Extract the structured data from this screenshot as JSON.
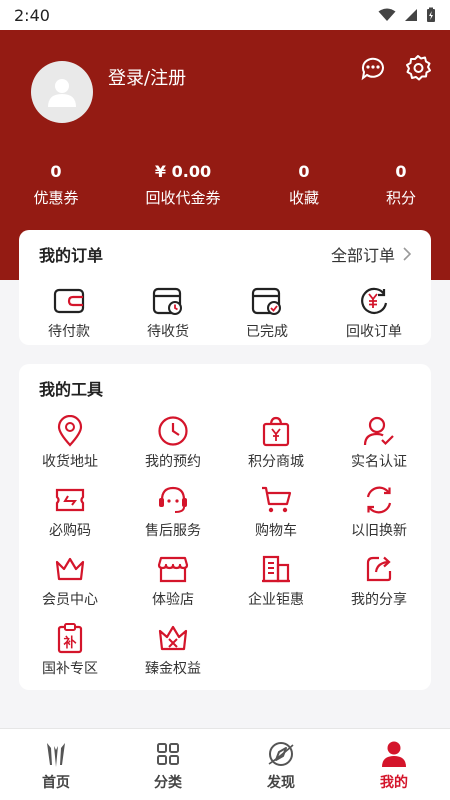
{
  "status_bar": {
    "time": "2:40"
  },
  "header": {
    "login_label": "登录/注册",
    "stats": [
      {
        "value": "0",
        "label": "优惠券"
      },
      {
        "value": "¥ 0.00",
        "label": "回收代金券"
      },
      {
        "value": "0",
        "label": "收藏"
      },
      {
        "value": "0",
        "label": "积分"
      }
    ]
  },
  "orders": {
    "title": "我的订单",
    "all_label": "全部订单",
    "items": [
      {
        "label": "待付款",
        "icon": "wallet-icon"
      },
      {
        "label": "待收货",
        "icon": "pending-delivery-icon"
      },
      {
        "label": "已完成",
        "icon": "completed-icon"
      },
      {
        "label": "回收订单",
        "icon": "recycle-order-icon"
      }
    ]
  },
  "tools": {
    "title": "我的工具",
    "items": [
      {
        "label": "收货地址",
        "icon": "location-icon"
      },
      {
        "label": "我的预约",
        "icon": "clock-icon"
      },
      {
        "label": "积分商城",
        "icon": "shopping-bag-icon"
      },
      {
        "label": "实名认证",
        "icon": "verified-user-icon"
      },
      {
        "label": "必购码",
        "icon": "code-ticket-icon"
      },
      {
        "label": "售后服务",
        "icon": "customer-service-icon"
      },
      {
        "label": "购物车",
        "icon": "cart-icon"
      },
      {
        "label": "以旧换新",
        "icon": "trade-in-icon"
      },
      {
        "label": "会员中心",
        "icon": "crown-icon"
      },
      {
        "label": "体验店",
        "icon": "store-icon"
      },
      {
        "label": "企业钜惠",
        "icon": "enterprise-icon"
      },
      {
        "label": "我的分享",
        "icon": "share-icon"
      },
      {
        "label": "国补专区",
        "icon": "subsidy-icon"
      },
      {
        "label": "臻金权益",
        "icon": "gold-benefit-icon"
      }
    ]
  },
  "tabbar": {
    "tabs": [
      {
        "label": "首页",
        "icon": "home-logo-icon",
        "active": false
      },
      {
        "label": "分类",
        "icon": "category-grid-icon",
        "active": false
      },
      {
        "label": "发现",
        "icon": "discover-compass-icon",
        "active": false
      },
      {
        "label": "我的",
        "icon": "profile-icon",
        "active": true
      }
    ]
  },
  "colors": {
    "header_bg": "#941b13",
    "accent_red": "#d4152b",
    "page_bg": "#f5f5f7"
  }
}
